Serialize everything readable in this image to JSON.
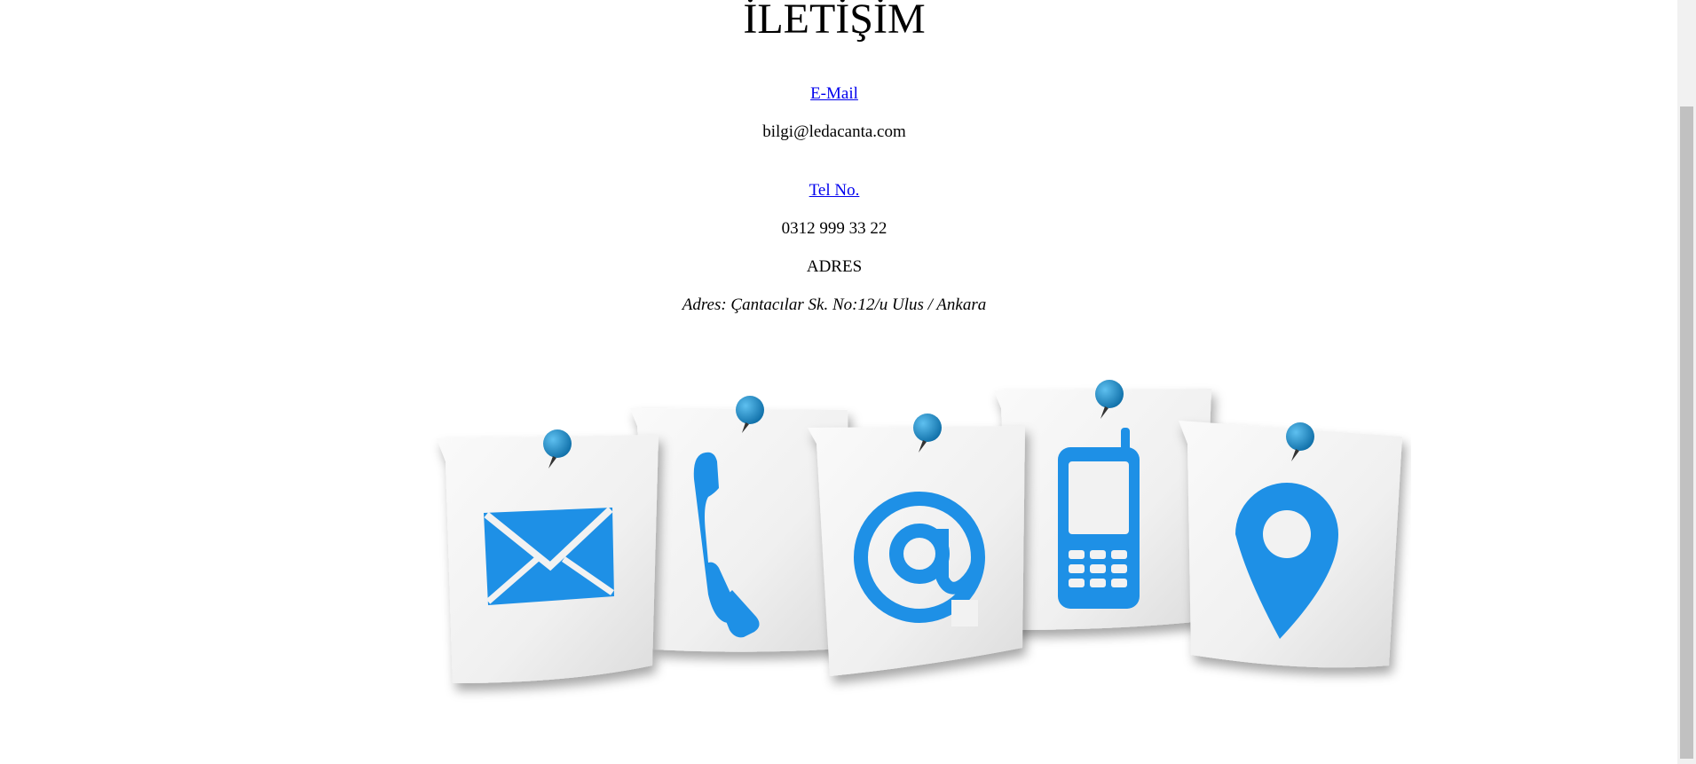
{
  "page": {
    "title": "İLETİŞİM"
  },
  "contact": {
    "email_link": "E-Mail",
    "email_value": "bilgi@ledacanta.com",
    "phone_link": "Tel No.",
    "phone_value": "0312 999 33 22",
    "address_heading": "ADRES",
    "address_value": "Adres: Çantacılar Sk. No:12/u Ulus / Ankara"
  },
  "illustration": {
    "cards": [
      {
        "icon": "envelope-icon"
      },
      {
        "icon": "phone-handset-icon"
      },
      {
        "icon": "at-sign-icon"
      },
      {
        "icon": "mobile-phone-icon"
      },
      {
        "icon": "location-pin-icon"
      }
    ],
    "accent": "#1e90e6",
    "pin_color": "#1a8fd6",
    "card_color": "#f2f2f2"
  }
}
